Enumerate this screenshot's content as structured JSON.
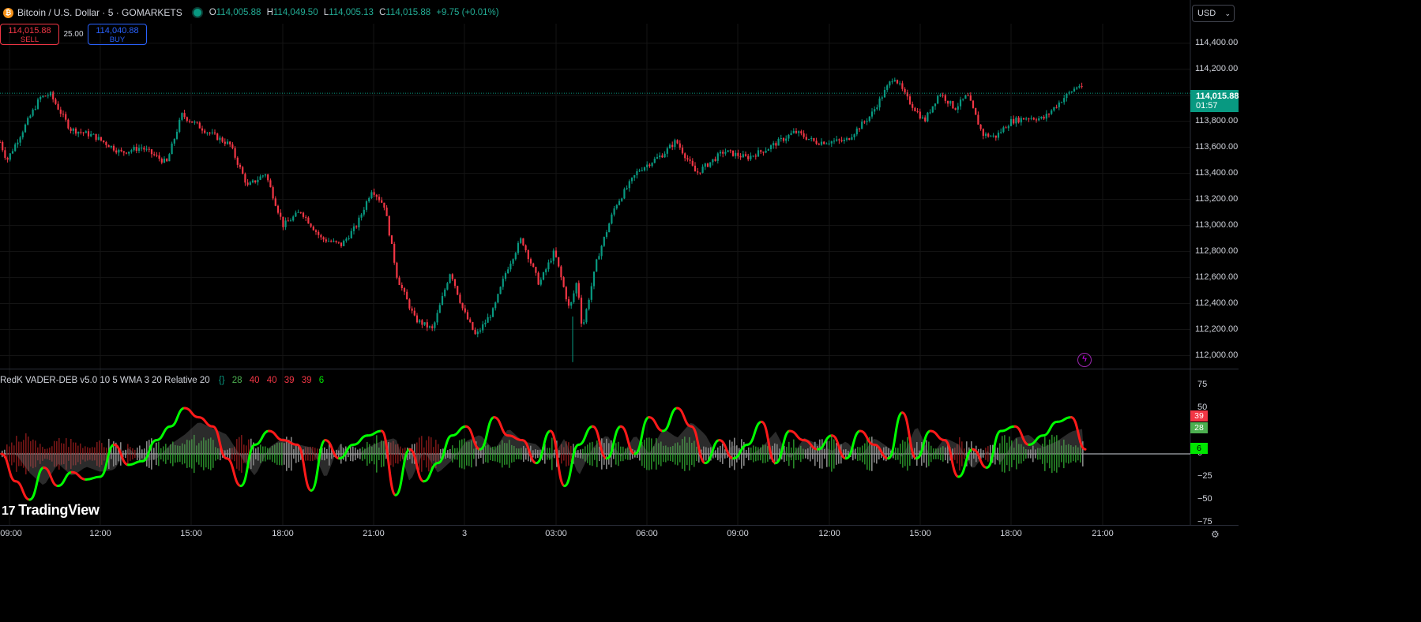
{
  "header": {
    "symbol": "Bitcoin / U.S. Dollar · 5 · GOMARKETS",
    "coin_icon": "bitcoin-icon",
    "ohlc": {
      "o_label": "O",
      "o": "114,005.88",
      "h_label": "H",
      "h": "114,049.50",
      "l_label": "L",
      "l": "114,005.13",
      "c_label": "C",
      "c": "114,015.88",
      "change": "+9.75 (+0.01%)"
    }
  },
  "trade": {
    "sell_price": "114,015.88",
    "sell_label": "SELL",
    "spread": "25.00",
    "buy_price": "114,040.88",
    "buy_label": "BUY"
  },
  "currency": "USD",
  "price_axis": {
    "ticks": [
      "114,400.00",
      "114,200.00",
      "113,800.00",
      "113,600.00",
      "113,400.00",
      "113,200.00",
      "113,000.00",
      "112,800.00",
      "112,600.00",
      "112,400.00",
      "112,200.00",
      "112,000.00"
    ],
    "last_price": "114,015.88",
    "countdown": "01:57"
  },
  "indicator": {
    "name": "RedK VADER-DEB v5.0 10 5 WMA 3 20 Relative 20",
    "values": [
      "28",
      "40",
      "40",
      "39",
      "39",
      "6"
    ],
    "axis_ticks": [
      "75",
      "50",
      "25",
      "0",
      "−25",
      "−50",
      "−75"
    ],
    "tags": {
      "red": "39",
      "green": "28",
      "lime": "6"
    }
  },
  "time_axis": [
    "09:00",
    "12:00",
    "15:00",
    "18:00",
    "21:00",
    "3",
    "03:00",
    "06:00",
    "09:00",
    "12:00",
    "15:00",
    "18:00",
    "21:00"
  ],
  "brand": "TradingView",
  "colors": {
    "up": "#089981",
    "down": "#f23645",
    "bg": "#000000",
    "signal_up": "#00ff00",
    "signal_down": "#ff1a1a"
  },
  "chart_data": [
    {
      "type": "candlestick",
      "title": "Bitcoin / U.S. Dollar · 5 · GOMARKETS",
      "x_ticks": [
        "09:00",
        "12:00",
        "15:00",
        "18:00",
        "21:00",
        "3",
        "03:00",
        "06:00",
        "09:00",
        "12:00",
        "15:00",
        "18:00",
        "21:00"
      ],
      "ylim": [
        111900,
        114550
      ],
      "grid": true,
      "close_path": [
        {
          "t": "08:20",
          "p": 113860
        },
        {
          "t": "08:55",
          "p": 113500
        },
        {
          "t": "10:00",
          "p": 113980
        },
        {
          "t": "10:20",
          "p": 114010
        },
        {
          "t": "11:00",
          "p": 113740
        },
        {
          "t": "11:45",
          "p": 113690
        },
        {
          "t": "12:40",
          "p": 113560
        },
        {
          "t": "13:20",
          "p": 113600
        },
        {
          "t": "14:10",
          "p": 113480
        },
        {
          "t": "14:40",
          "p": 113850
        },
        {
          "t": "15:30",
          "p": 113720
        },
        {
          "t": "16:15",
          "p": 113620
        },
        {
          "t": "16:50",
          "p": 113300
        },
        {
          "t": "17:25",
          "p": 113400
        },
        {
          "t": "18:00",
          "p": 113000
        },
        {
          "t": "18:35",
          "p": 113110
        },
        {
          "t": "19:15",
          "p": 112900
        },
        {
          "t": "19:55",
          "p": 112850
        },
        {
          "t": "20:25",
          "p": 113000
        },
        {
          "t": "20:55",
          "p": 113280
        },
        {
          "t": "21:20",
          "p": 113150
        },
        {
          "t": "21:45",
          "p": 112600
        },
        {
          "t": "22:20",
          "p": 112280
        },
        {
          "t": "22:55",
          "p": 112200
        },
        {
          "t": "23:30",
          "p": 112650
        },
        {
          "t": "23:55",
          "p": 112350
        },
        {
          "t": "00:20",
          "p": 112150
        },
        {
          "t": "00:55",
          "p": 112350
        },
        {
          "t": "01:20",
          "p": 112650
        },
        {
          "t": "01:50",
          "p": 112900
        },
        {
          "t": "02:25",
          "p": 112550
        },
        {
          "t": "02:55",
          "p": 112800
        },
        {
          "t": "03:25",
          "p": 112350
        },
        {
          "t": "03:40",
          "p": 112580
        },
        {
          "t": "03:50",
          "p": 112200
        },
        {
          "t": "04:20",
          "p": 112750
        },
        {
          "t": "04:55",
          "p": 113150
        },
        {
          "t": "05:40",
          "p": 113420
        },
        {
          "t": "06:30",
          "p": 113550
        },
        {
          "t": "06:55",
          "p": 113650
        },
        {
          "t": "07:35",
          "p": 113400
        },
        {
          "t": "08:30",
          "p": 113570
        },
        {
          "t": "09:15",
          "p": 113520
        },
        {
          "t": "09:55",
          "p": 113590
        },
        {
          "t": "10:50",
          "p": 113720
        },
        {
          "t": "11:30",
          "p": 113640
        },
        {
          "t": "12:30",
          "p": 113650
        },
        {
          "t": "13:20",
          "p": 113850
        },
        {
          "t": "14:05",
          "p": 114150
        },
        {
          "t": "14:30",
          "p": 113980
        },
        {
          "t": "15:05",
          "p": 113800
        },
        {
          "t": "15:35",
          "p": 114020
        },
        {
          "t": "16:05",
          "p": 113900
        },
        {
          "t": "16:30",
          "p": 114000
        },
        {
          "t": "17:00",
          "p": 113700
        },
        {
          "t": "17:25",
          "p": 113680
        },
        {
          "t": "17:55",
          "p": 113800
        },
        {
          "t": "18:30",
          "p": 113830
        },
        {
          "t": "19:00",
          "p": 113820
        },
        {
          "t": "19:40",
          "p": 113980
        },
        {
          "t": "20:10",
          "p": 114080
        },
        {
          "t": "20:20",
          "p": 114015.88
        }
      ],
      "last_price": 114015.88
    },
    {
      "type": "line",
      "title": "RedK VADER-DEB v5.0 10 5 WMA 3 20 Relative 20",
      "ylim": [
        -75,
        75
      ],
      "y_ticks": [
        75,
        50,
        25,
        0,
        -25,
        -50,
        -75
      ],
      "series": [
        {
          "name": "",
          "values": [
            0,
            -30,
            -50,
            -15,
            -35,
            -20,
            -28,
            -25,
            10,
            -12,
            -8,
            15,
            30,
            50,
            40,
            30,
            -5,
            -35,
            10,
            25,
            15,
            10,
            -40,
            15,
            -5,
            10,
            20,
            25,
            -45,
            5,
            -30,
            -10,
            20,
            30,
            5,
            40,
            20,
            15,
            -10,
            25,
            -35,
            10,
            30,
            -5,
            30,
            0,
            40,
            25,
            50,
            30,
            -10,
            15,
            -5,
            10,
            35,
            -10,
            25,
            15,
            5,
            20,
            -5,
            25,
            10,
            -5,
            45,
            -5,
            25,
            15,
            -25,
            5,
            -15,
            25,
            30,
            10,
            20,
            35,
            40,
            5
          ]
        }
      ],
      "signal_last": 6
    }
  ]
}
